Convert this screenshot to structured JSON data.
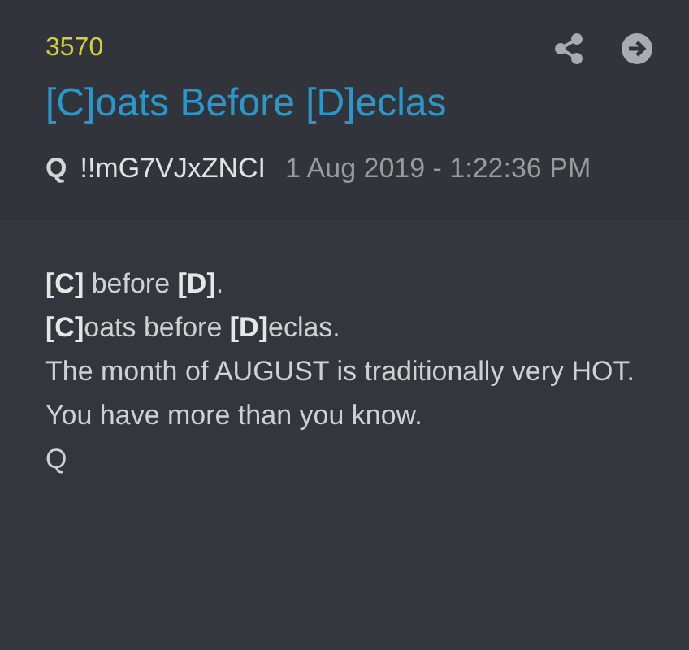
{
  "post": {
    "number": "3570",
    "title": "[C]oats Before [D]eclas",
    "author": "Q",
    "tripcode": "!!mG7VJxZNCI",
    "timestamp": "1 Aug 2019 - 1:22:36 PM"
  },
  "body": [
    "**[C]** before **[D]**.",
    "**[C]**oats before **[D]**eclas.",
    "The month of AUGUST is traditionally very HOT.",
    "You have more than you know.",
    "Q"
  ]
}
